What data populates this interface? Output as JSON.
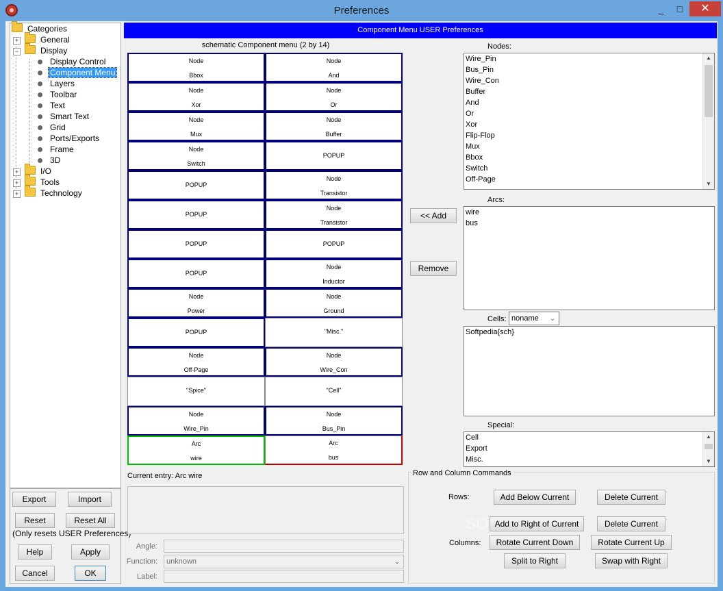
{
  "window": {
    "title": "Preferences",
    "minimize": "_",
    "maximize": "□",
    "close": "✕"
  },
  "tree": {
    "root": "Categories",
    "general": "General",
    "display": "Display",
    "display_children": [
      "Display Control",
      "Component Menu",
      "Layers",
      "Toolbar",
      "Text",
      "Smart Text",
      "Grid",
      "Ports/Exports",
      "Frame",
      "3D"
    ],
    "io": "I/O",
    "tools": "Tools",
    "technology": "Technology",
    "selected": "Component Menu"
  },
  "left_buttons": {
    "export": "Export",
    "import": "Import",
    "reset": "Reset",
    "reset_all": "Reset All",
    "reset_note": "(Only resets USER Preferences)",
    "help": "Help",
    "apply": "Apply",
    "cancel": "Cancel",
    "ok": "OK"
  },
  "panel": {
    "header": "Component Menu USER Preferences",
    "grid_title": "schematic Component menu (2 by 14)",
    "grid": [
      [
        [
          "Node",
          "Bbox"
        ],
        [
          "Node",
          "And"
        ]
      ],
      [
        [
          "Node",
          "Xor"
        ],
        [
          "Node",
          "Or"
        ]
      ],
      [
        [
          "Node",
          "Mux"
        ],
        [
          "Node",
          "Buffer"
        ]
      ],
      [
        [
          "Node",
          "Switch"
        ],
        [
          "POPUP"
        ]
      ],
      [
        [
          "POPUP"
        ],
        [
          "Node",
          "Transistor"
        ]
      ],
      [
        [
          "POPUP"
        ],
        [
          "Node",
          "Transistor"
        ]
      ],
      [
        [
          "POPUP"
        ],
        [
          "POPUP"
        ]
      ],
      [
        [
          "POPUP"
        ],
        [
          "Node",
          "Inductor"
        ]
      ],
      [
        [
          "Node",
          "Power"
        ],
        [
          "Node",
          "Ground"
        ]
      ],
      [
        [
          "POPUP"
        ],
        [
          "\"Misc.\""
        ]
      ],
      [
        [
          "Node",
          "Off-Page"
        ],
        [
          "Node",
          "Wire_Con"
        ]
      ],
      [
        [
          "\"Spice\""
        ],
        [
          "\"Cell\""
        ]
      ],
      [
        [
          "Node",
          "Wire_Pin"
        ],
        [
          "Node",
          "Bus_Pin"
        ]
      ],
      [
        [
          "Arc",
          "wire"
        ],
        [
          "Arc",
          "bus"
        ]
      ]
    ],
    "current_entry": "Current entry: Arc wire",
    "angle_label": "Angle:",
    "function_label": "Function:",
    "function_value": "unknown",
    "label_label": "Label:",
    "add_button": "<< Add",
    "remove_button": "Remove",
    "nodes_label": "Nodes:",
    "nodes": [
      "Wire_Pin",
      "Bus_Pin",
      "Wire_Con",
      "Buffer",
      "And",
      "Or",
      "Xor",
      "Flip-Flop",
      "Mux",
      "Bbox",
      "Switch",
      "Off-Page"
    ],
    "arcs_label": "Arcs:",
    "arcs": [
      "wire",
      "bus"
    ],
    "cells_label": "Cells:",
    "cells_combo": "noname",
    "cells": [
      "Softpedia{sch}"
    ],
    "special_label": "Special:",
    "special": [
      "Cell",
      "Export",
      "Misc."
    ],
    "rc_title": "Row and Column Commands",
    "rows_label": "Rows:",
    "add_below": "Add Below Current",
    "delete_row": "Delete Current",
    "add_right": "Add to Right of Current",
    "delete_col": "Delete Current",
    "columns_label": "Columns:",
    "rotate_down": "Rotate Current Down",
    "rotate_up": "Rotate Current Up",
    "split_right": "Split to Right",
    "swap_right": "Swap with Right"
  },
  "watermark": "SOFTPEDIA",
  "colors": {
    "header_bar": "#0000ff",
    "cell_border": "#00007f",
    "selected_green": "#00c000",
    "selected_red": "#c00000",
    "tree_selection": "#3399ff"
  }
}
